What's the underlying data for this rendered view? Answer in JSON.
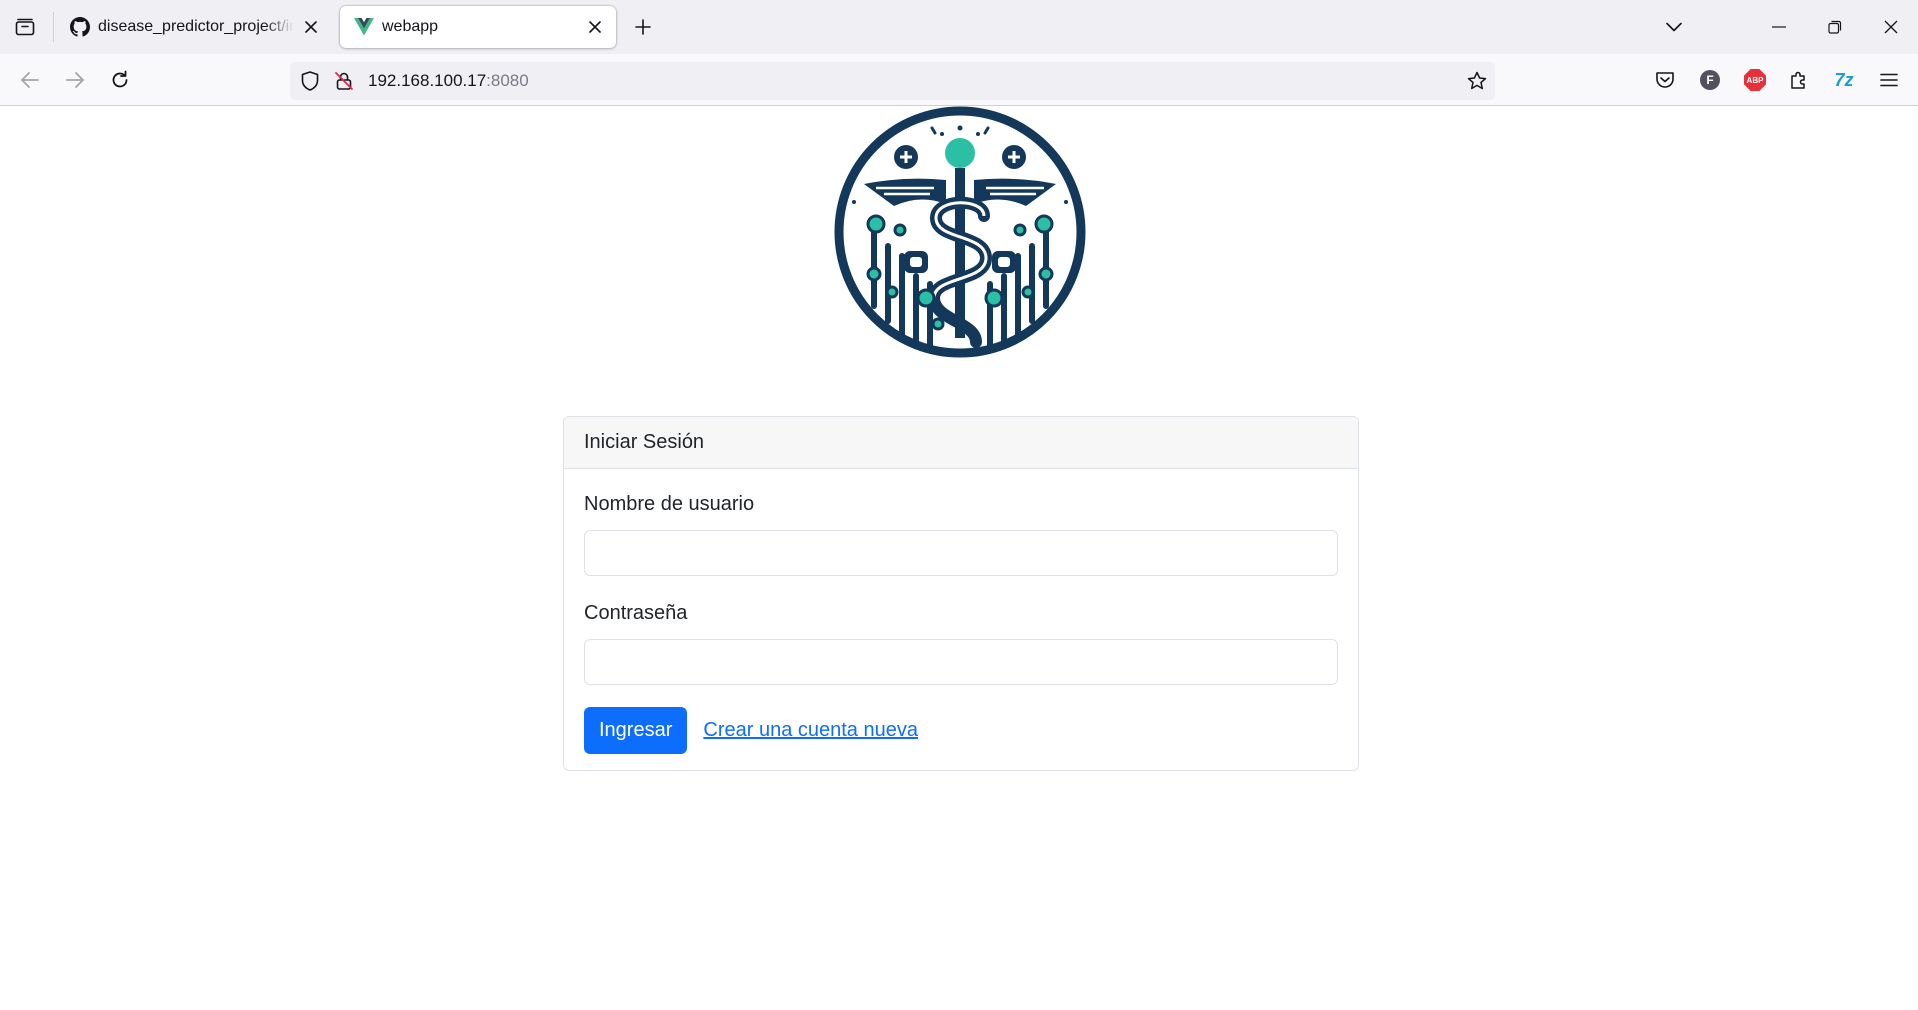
{
  "browser": {
    "tabs": [
      {
        "title": "disease_predictor_project/images",
        "favicon": "github-icon",
        "active": false
      },
      {
        "title": "webapp",
        "favicon": "vue-icon",
        "active": true
      }
    ],
    "url": {
      "host": "192.168.100.17",
      "port": ":8080"
    },
    "toolbar_icons": [
      "pocket-icon",
      "account-f-icon",
      "adblock-plus-icon",
      "extensions-icon",
      "translate-icon",
      "menu-icon"
    ],
    "account_letter": "F",
    "abp_label": "ABP",
    "translate_label": "7z"
  },
  "logo": {
    "name": "medical-circuit-logo",
    "colors": {
      "navy": "#14385a",
      "teal": "#27a99a"
    }
  },
  "login": {
    "header": "Iniciar Sesión",
    "username_label": "Nombre de usuario",
    "username_value": "",
    "password_label": "Contraseña",
    "password_value": "",
    "submit_label": "Ingresar",
    "register_link": "Crear una cuenta nueva"
  },
  "colors": {
    "primary": "#0d6efd",
    "tabbar": "#f0f0f4",
    "border": "#dee2e6"
  }
}
